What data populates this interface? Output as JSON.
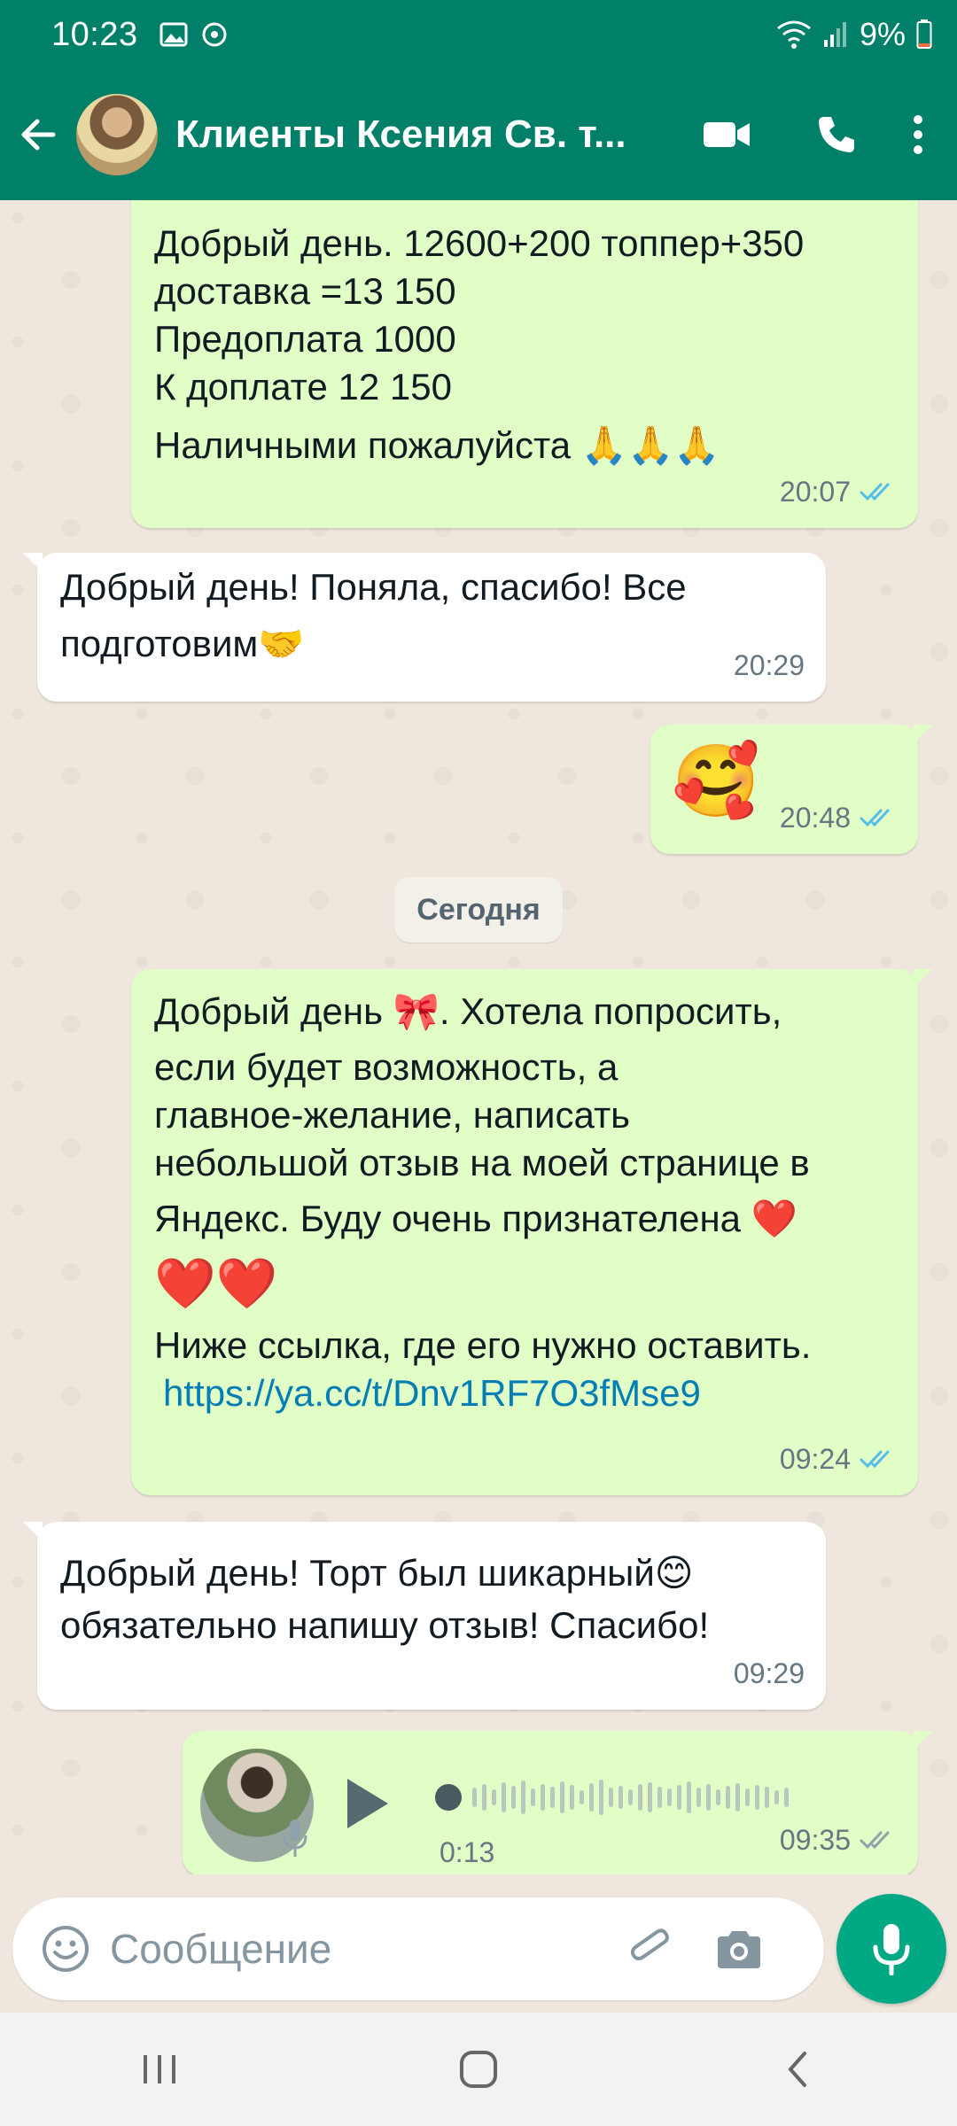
{
  "status_bar": {
    "time": "10:23",
    "battery": "9%"
  },
  "header": {
    "contact_name": "Клиенты Ксения Св. т..."
  },
  "messages": [
    {
      "direction": "out",
      "lines": [
        "Добрый день.  12600+200 топпер+350",
        "доставка =13 150",
        "Предоплата 1000",
        "К доплате  12 150",
        "Наличными пожалуйста"
      ],
      "emoji": "🙏🙏🙏",
      "time": "20:07"
    },
    {
      "direction": "in",
      "lines": [
        "Добрый день! Поняла, спасибо! Все",
        "подготовим"
      ],
      "emoji": "🤝",
      "time": "20:29"
    },
    {
      "direction": "out",
      "emoji": "🥰",
      "time": "20:48"
    },
    {
      "direction": "out",
      "line1_a": "Добрый день",
      "line1_emoji": "🎀",
      "line1_b": ".  Хотела попросить,",
      "lines": [
        "если будет возможность,  а",
        "главное-желание,  написать",
        "небольшой отзыв на моей странице в"
      ],
      "line5": "Яндекс.  Буду очень признателена",
      "hearts": "❤️",
      "hearts2": "❤️❤️",
      "line7": "Ниже ссылка, где его нужно оставить.",
      "link": "https://ya.cc/t/Dnv1RF7O3fMse9",
      "time": "09:24"
    },
    {
      "direction": "in",
      "line1": "Добрый день! Торт был шикарный",
      "emoji": "😊",
      "line2": "обязательно напишу отзыв! Спасибо!",
      "time": "09:29"
    },
    {
      "direction": "out",
      "type": "voice",
      "duration": "0:13",
      "progress": 0,
      "time": "09:35"
    }
  ],
  "date_divider": "Сегодня",
  "composer": {
    "placeholder": "Сообщение"
  },
  "colors": {
    "header_green": "#008069",
    "outgoing_bubble": "#e1fec6",
    "incoming_bubble": "#ffffff",
    "read_ticks": "#53bdeb",
    "mic_button": "#00a884",
    "link": "#027eb5"
  },
  "icons": {
    "back": "arrow-left-icon",
    "video": "video-camera-icon",
    "call": "phone-icon",
    "menu": "more-vert-icon",
    "emoji": "emoji-icon",
    "attach": "paperclip-icon",
    "camera": "camera-icon",
    "mic": "microphone-icon",
    "read": "double-check-icon"
  }
}
